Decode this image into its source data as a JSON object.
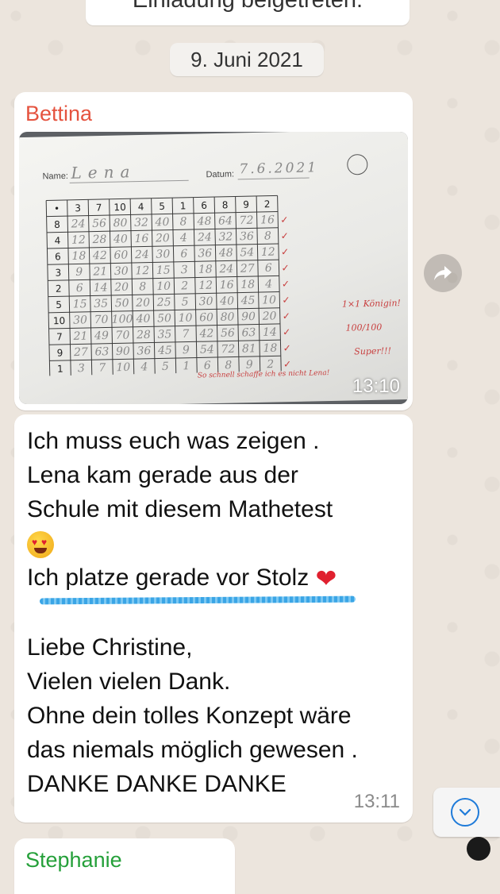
{
  "chat": {
    "system_message": "Einladung beigetreten.",
    "date_label": "9. Juni 2021"
  },
  "photo_message": {
    "sender": "Bettina",
    "sender_color": "#e5533f",
    "time": "13:10",
    "worksheet": {
      "name_label": "Name:",
      "name_value": "Lena",
      "date_label": "Datum:",
      "date_value": "7.6.2021",
      "header_row": [
        "•",
        "3",
        "7",
        "10",
        "4",
        "5",
        "1",
        "6",
        "8",
        "9",
        "2"
      ],
      "row_factors": [
        "8",
        "4",
        "6",
        "3",
        "2",
        "5",
        "10",
        "7",
        "9",
        "1"
      ],
      "note_1": "1×1 Königin!",
      "note_2": "100/100",
      "note_3": "Super!!!",
      "note_4": "So schnell schaffe ich es nicht Lena!"
    }
  },
  "text_message": {
    "lines": [
      "Ich muss euch was zeigen .",
      "Lena kam gerade aus der",
      "Schule mit diesem Mathetest"
    ],
    "line_stolz": "Ich platze gerade vor Stolz",
    "lines_2": [
      "Liebe Christine,",
      "Vielen vielen Dank.",
      "Ohne dein tolles Konzept wäre",
      "das niemals möglich gewesen .",
      "DANKE DANKE DANKE"
    ],
    "time": "13:11",
    "emoji_1": "heart-eyes-emoji",
    "emoji_2": "red-heart-emoji"
  },
  "next_message": {
    "sender": "Stephanie",
    "sender_color": "#25a03a"
  },
  "icons": {
    "forward": "forward-arrow-icon",
    "scroll_down": "chevron-down-icon"
  },
  "colors": {
    "chat_background": "#ece5dd",
    "bubble": "#ffffff",
    "link_blue": "#1f7bd9",
    "time_gray": "#8a8a8a"
  }
}
